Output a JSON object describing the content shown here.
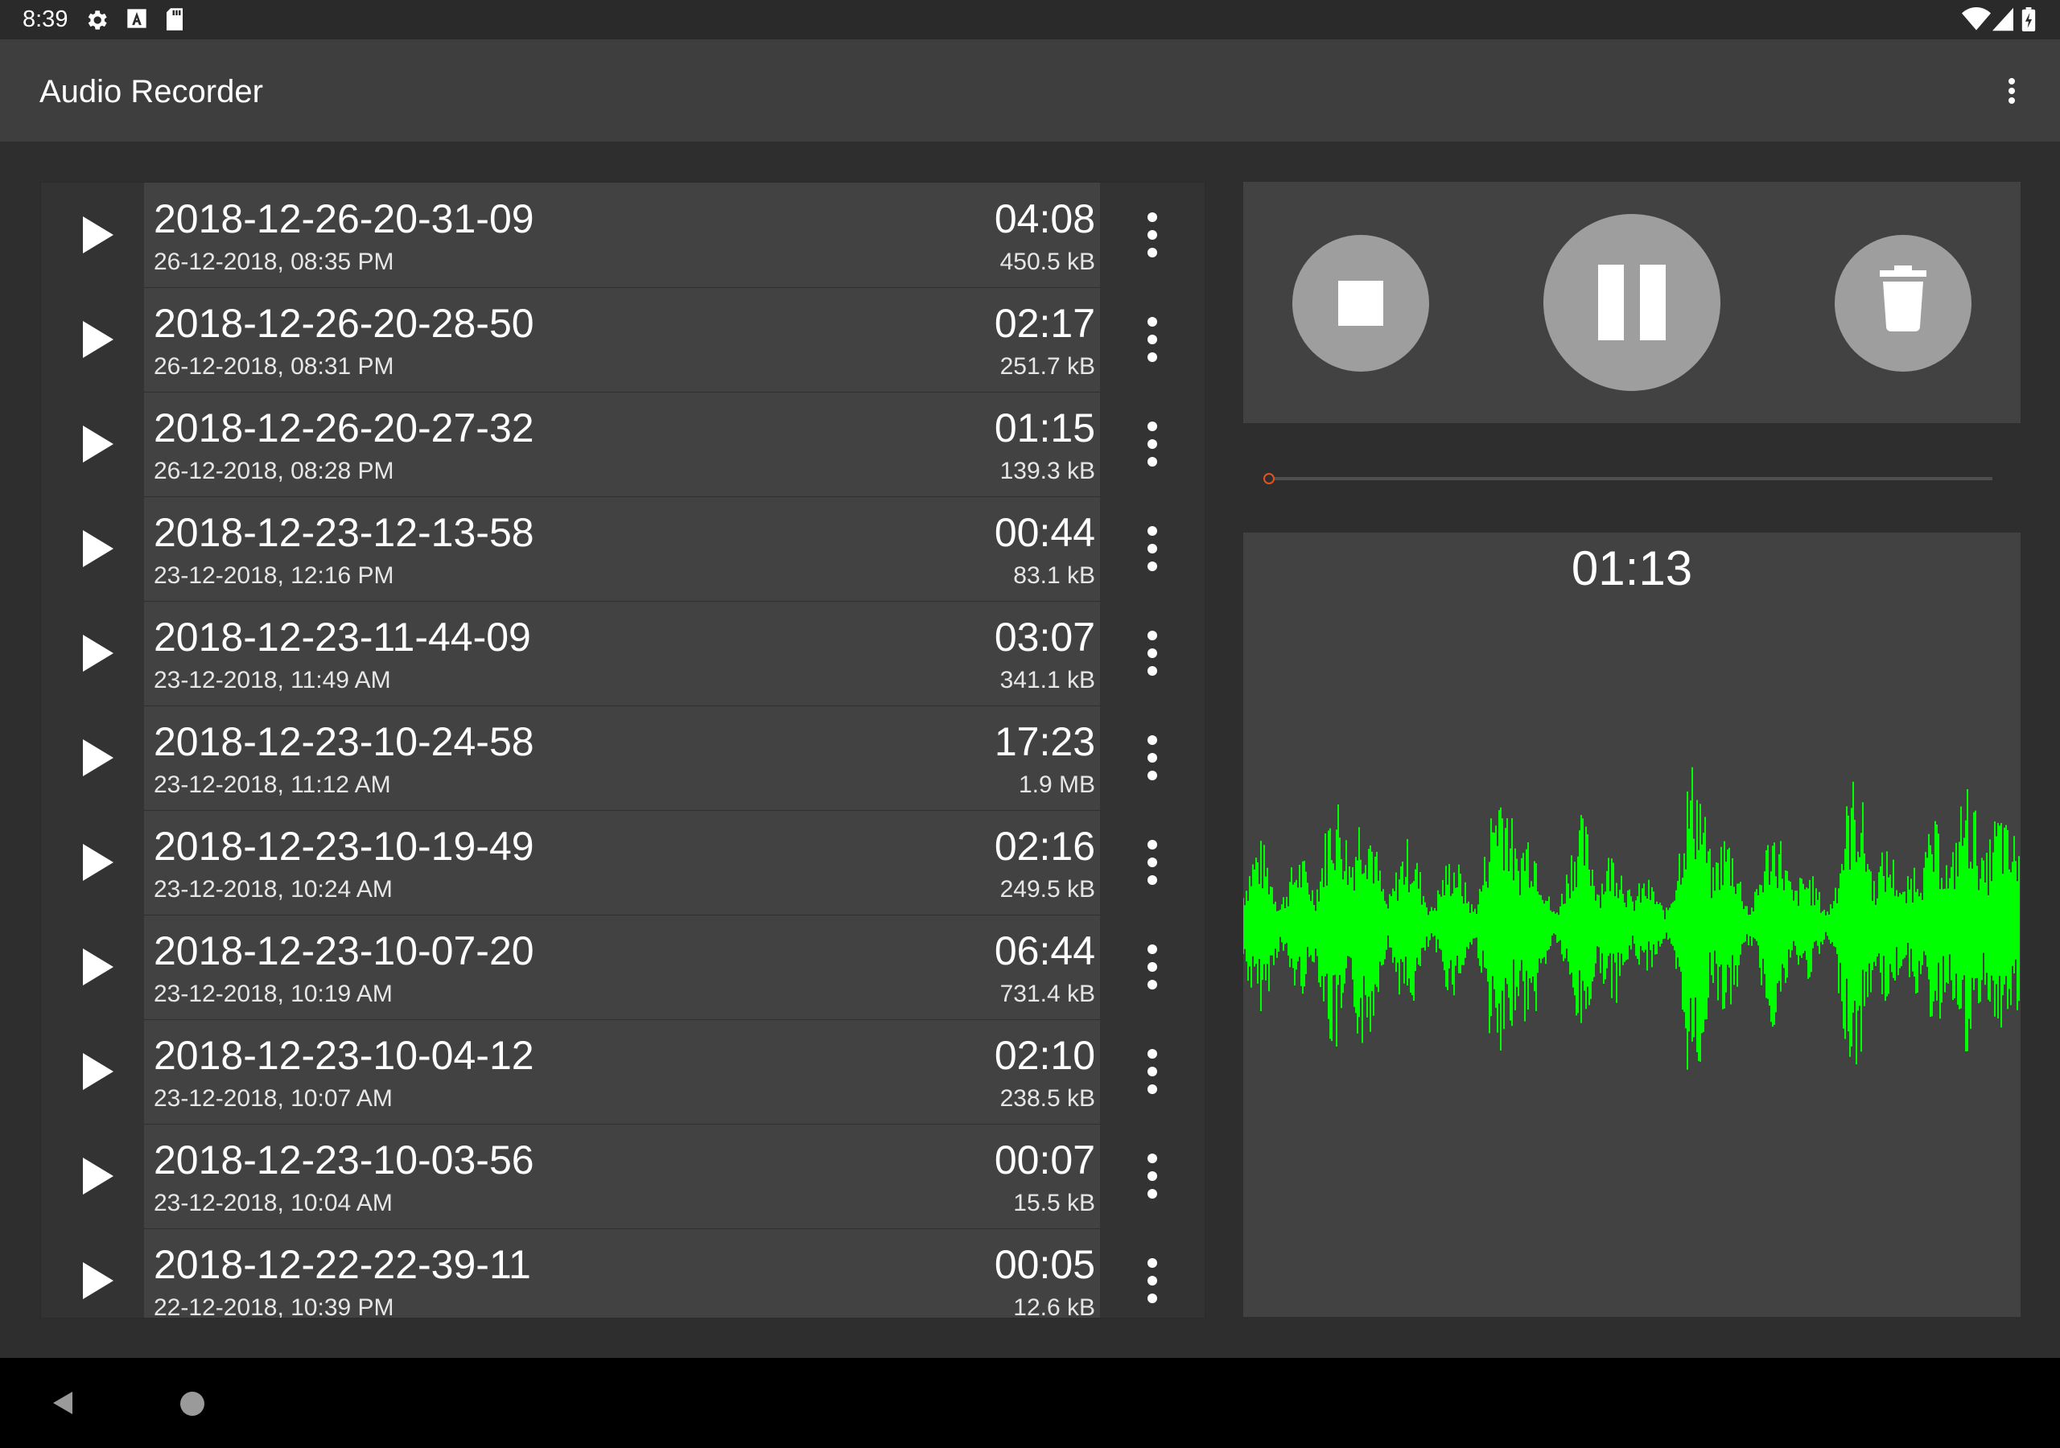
{
  "status_bar": {
    "time": "8:39",
    "left_icons": [
      "settings-icon",
      "keyboard-a-icon",
      "sd-card-icon"
    ],
    "right_icons": [
      "wifi-icon",
      "signal-icon",
      "battery-icon"
    ]
  },
  "app_bar": {
    "title": "Audio Recorder",
    "overflow_icon": "more-vert-icon"
  },
  "recordings": [
    {
      "name": "2018-12-26-20-31-09",
      "date": "26-12-2018, 08:35 PM",
      "duration": "04:08",
      "size": "450.5 kB"
    },
    {
      "name": "2018-12-26-20-28-50",
      "date": "26-12-2018, 08:31 PM",
      "duration": "02:17",
      "size": "251.7 kB"
    },
    {
      "name": "2018-12-26-20-27-32",
      "date": "26-12-2018, 08:28 PM",
      "duration": "01:15",
      "size": "139.3 kB"
    },
    {
      "name": "2018-12-23-12-13-58",
      "date": "23-12-2018, 12:16 PM",
      "duration": "00:44",
      "size": "83.1 kB"
    },
    {
      "name": "2018-12-23-11-44-09",
      "date": "23-12-2018, 11:49 AM",
      "duration": "03:07",
      "size": "341.1 kB"
    },
    {
      "name": "2018-12-23-10-24-58",
      "date": "23-12-2018, 11:12 AM",
      "duration": "17:23",
      "size": "1.9 MB"
    },
    {
      "name": "2018-12-23-10-19-49",
      "date": "23-12-2018, 10:24 AM",
      "duration": "02:16",
      "size": "249.5 kB"
    },
    {
      "name": "2018-12-23-10-07-20",
      "date": "23-12-2018, 10:19 AM",
      "duration": "06:44",
      "size": "731.4 kB"
    },
    {
      "name": "2018-12-23-10-04-12",
      "date": "23-12-2018, 10:07 AM",
      "duration": "02:10",
      "size": "238.5 kB"
    },
    {
      "name": "2018-12-23-10-03-56",
      "date": "23-12-2018, 10:04 AM",
      "duration": "00:07",
      "size": "15.5 kB"
    },
    {
      "name": "2018-12-22-22-39-11",
      "date": "22-12-2018, 10:39 PM",
      "duration": "00:05",
      "size": "12.6 kB"
    }
  ],
  "player": {
    "elapsed": "01:13",
    "progress_fraction": 0.0,
    "buttons": [
      "stop-icon",
      "pause-icon",
      "delete-icon"
    ],
    "waveform_color": "#00ff00"
  },
  "colors": {
    "accent": "#e2541d",
    "panel": "#424242",
    "background": "#2e2e2e"
  },
  "nav_bar": {
    "icons": [
      "back-icon",
      "home-icon"
    ]
  }
}
